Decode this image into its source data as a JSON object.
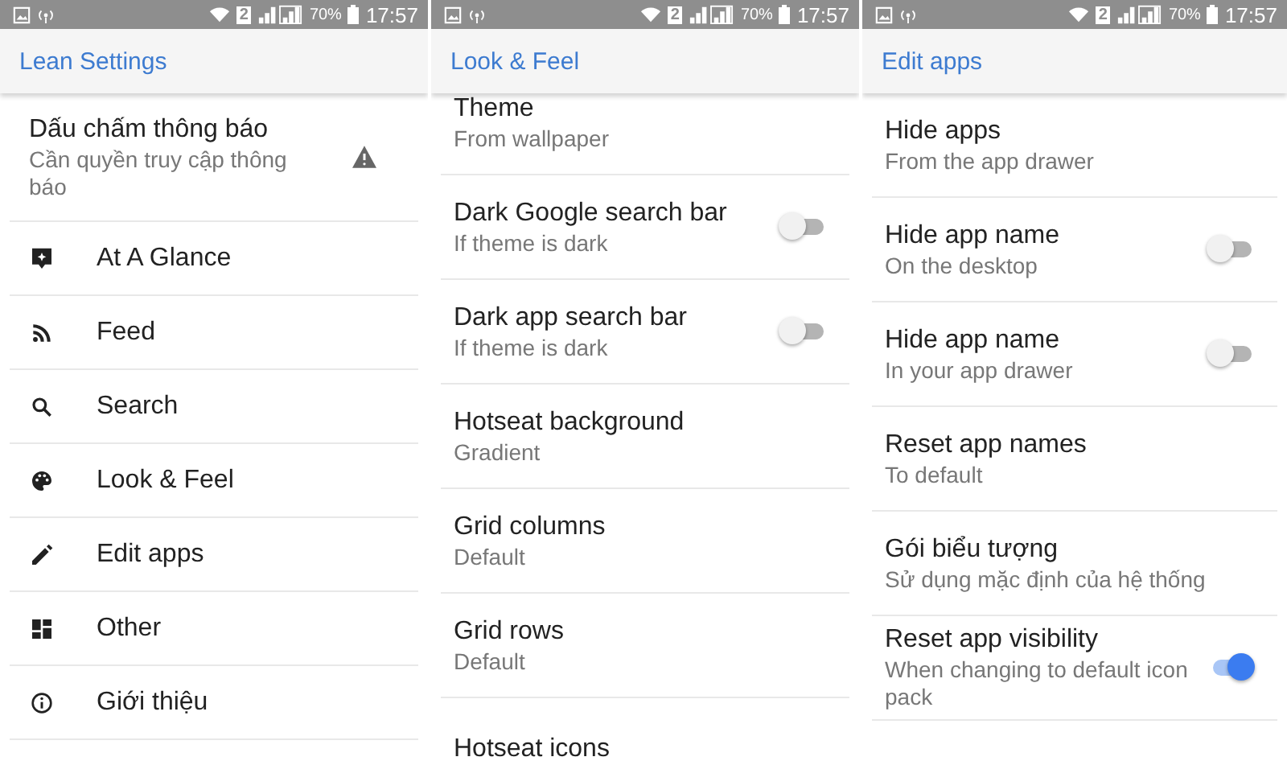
{
  "screens": [
    {
      "status_bar": {
        "sim": "2",
        "battery": "70%",
        "time": "17:57"
      },
      "toolbar": {
        "title": "Lean Settings"
      },
      "items": [
        {
          "kind": "warning",
          "title": "Dấu chấm thông báo",
          "subtitle": "Cần quyền truy cập thông báo"
        },
        {
          "kind": "nav",
          "title": "At A Glance"
        },
        {
          "kind": "nav",
          "title": "Feed"
        },
        {
          "kind": "nav",
          "title": "Search"
        },
        {
          "kind": "nav",
          "title": "Look & Feel"
        },
        {
          "kind": "nav",
          "title": "Edit apps"
        },
        {
          "kind": "nav",
          "title": "Other"
        },
        {
          "kind": "nav",
          "title": "Giới thiệu"
        }
      ]
    },
    {
      "status_bar": {
        "sim": "2",
        "battery": "70%",
        "time": "17:57"
      },
      "toolbar": {
        "title": "Look & Feel"
      },
      "items": [
        {
          "kind": "text",
          "title": "Theme",
          "subtitle": "From wallpaper"
        },
        {
          "kind": "switch",
          "title": "Dark Google search bar",
          "subtitle": "If theme is dark",
          "on": false
        },
        {
          "kind": "switch",
          "title": "Dark app search bar",
          "subtitle": "If theme is dark",
          "on": false
        },
        {
          "kind": "text",
          "title": "Hotseat background",
          "subtitle": "Gradient"
        },
        {
          "kind": "text",
          "title": "Grid columns",
          "subtitle": "Default"
        },
        {
          "kind": "text",
          "title": "Grid rows",
          "subtitle": "Default"
        },
        {
          "kind": "text",
          "title": "Hotseat icons"
        }
      ]
    },
    {
      "status_bar": {
        "sim": "2",
        "battery": "70%",
        "time": "17:57"
      },
      "toolbar": {
        "title": "Edit apps"
      },
      "items": [
        {
          "kind": "text",
          "title": "Hide apps",
          "subtitle": "From the app drawer"
        },
        {
          "kind": "switch",
          "title": "Hide app name",
          "subtitle": "On the desktop",
          "on": false
        },
        {
          "kind": "switch",
          "title": "Hide app name",
          "subtitle": "In your app drawer",
          "on": false
        },
        {
          "kind": "text",
          "title": "Reset app names",
          "subtitle": "To default"
        },
        {
          "kind": "text",
          "title": "Gói biểu tượng",
          "subtitle": "Sử dụng mặc định của hệ thống"
        },
        {
          "kind": "switch",
          "title": "Reset app visibility",
          "subtitle": "When changing to default icon pack",
          "on": true
        }
      ]
    }
  ]
}
